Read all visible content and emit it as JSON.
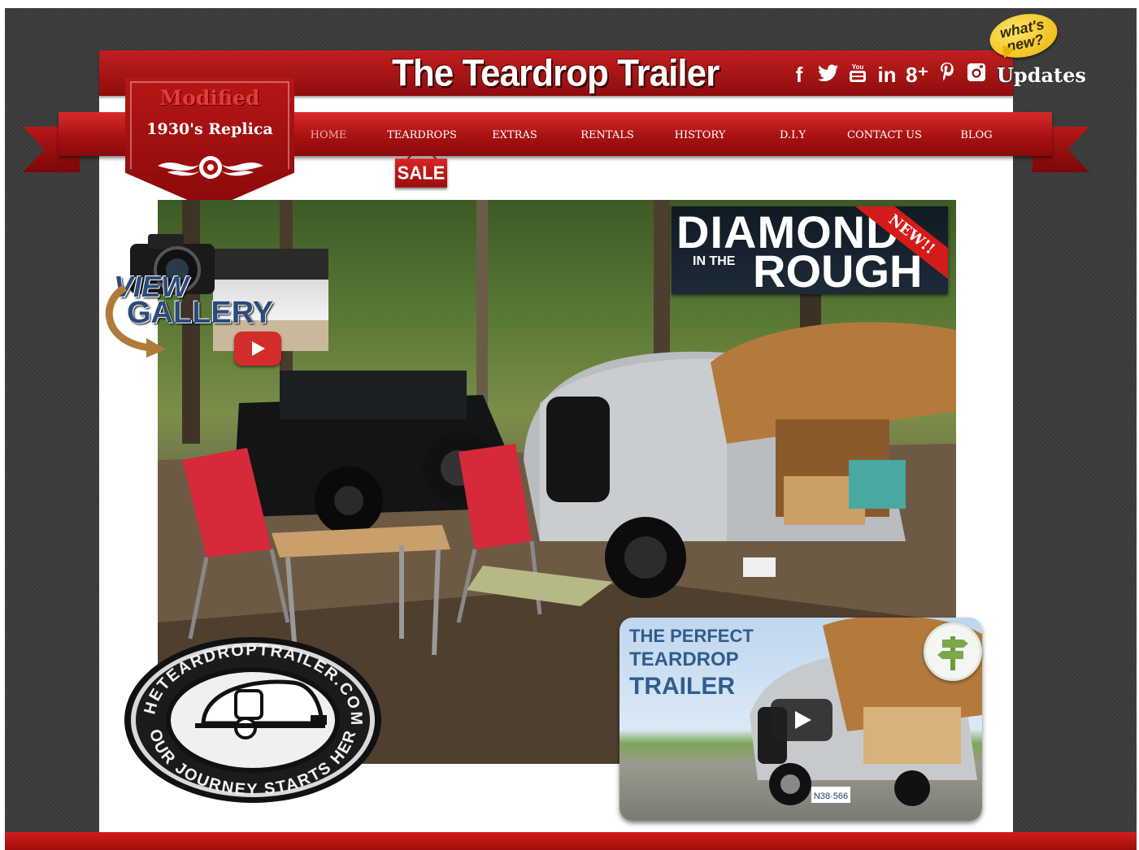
{
  "site": {
    "title": "The Teardrop Trailer"
  },
  "logo": {
    "line1": "Modified",
    "line2": "1930's Replica"
  },
  "social": [
    {
      "icon": "facebook-icon",
      "glyph": "f"
    },
    {
      "icon": "twitter-icon",
      "glyph": "🐦"
    },
    {
      "icon": "youtube-icon",
      "glyph": "▶"
    },
    {
      "icon": "linkedin-icon",
      "glyph": "in"
    },
    {
      "icon": "googleplus-icon",
      "glyph": "8⁺"
    },
    {
      "icon": "pinterest-icon",
      "glyph": "𝒑"
    },
    {
      "icon": "instagram-icon",
      "glyph": "◙"
    }
  ],
  "updates": {
    "label": "Updates",
    "badge_line1": "what's",
    "badge_line2": "new?"
  },
  "nav": {
    "items": [
      "HOME",
      "TEARDROPS",
      "EXTRAS",
      "RENTALS",
      "HISTORY",
      "D.I.Y",
      "CONTACT US",
      "BLOG"
    ],
    "active": "HOME"
  },
  "sale_tag": "SALE",
  "gallery": {
    "line1": "VIEW",
    "line2": "GALLERY"
  },
  "promo": {
    "line1": "DIAMOND",
    "line2": "IN THE",
    "line3": "ROUGH",
    "badge": "NEW!!"
  },
  "video": {
    "line1": "THE PERFECT",
    "line2": "TEARDROP",
    "line3": "TRAILER",
    "plate": "N38·566"
  },
  "medallion": {
    "top_text": "THETEARDROPTRAILER.COM",
    "bottom_text": "YOUR JOURNEY STARTS HERE"
  },
  "colors": {
    "brand_red": "#b71616",
    "background": "#3b3b3b",
    "accent_yellow": "#e8b300"
  }
}
